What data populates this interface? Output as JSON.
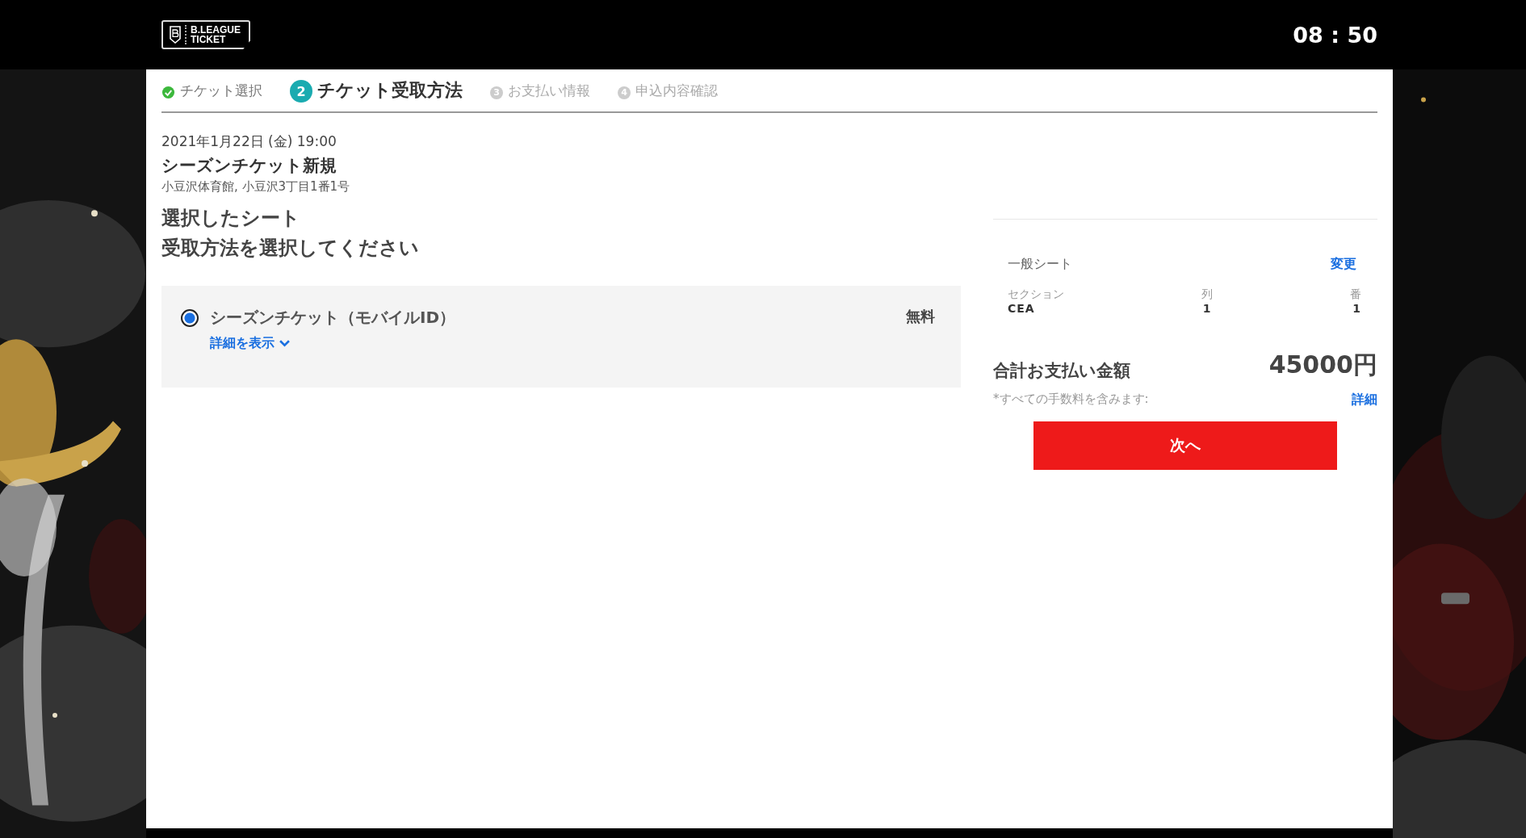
{
  "header": {
    "logo": [
      "B.LEAGUE",
      "TICKET"
    ],
    "timer": "08 : 50"
  },
  "steps": [
    {
      "label": "チケット選択",
      "kind": "done"
    },
    {
      "number": "2",
      "label": "チケット受取方法",
      "kind": "current"
    },
    {
      "number": "3",
      "label": "お支払い情報",
      "kind": "pending"
    },
    {
      "number": "4",
      "label": "申込内容確認",
      "kind": "pending"
    }
  ],
  "event": {
    "date": "2021年1月22日 (金) 19:00",
    "title": "シーズンチケット新規",
    "venue": "小豆沢体育館, 小豆沢3丁目1番1号"
  },
  "headings": [
    "選択したシート",
    "受取方法を選択してください"
  ],
  "delivery_options": [
    {
      "label": "シーズンチケット（モバイルID）",
      "price": "無料",
      "details_link": "詳細を表示",
      "selected": true
    }
  ],
  "seat": {
    "type": "一般シート",
    "change_link": "変更",
    "columns": [
      {
        "heading": "セクション",
        "value": "CEA"
      },
      {
        "heading": "列",
        "value": "1"
      },
      {
        "heading": "番",
        "value": "1"
      }
    ]
  },
  "total": {
    "label": "合計お支払い金額",
    "amount": "45000円",
    "note": "*すべての手数料を含みます:",
    "details_link": "詳細"
  },
  "next_button": "次へ"
}
